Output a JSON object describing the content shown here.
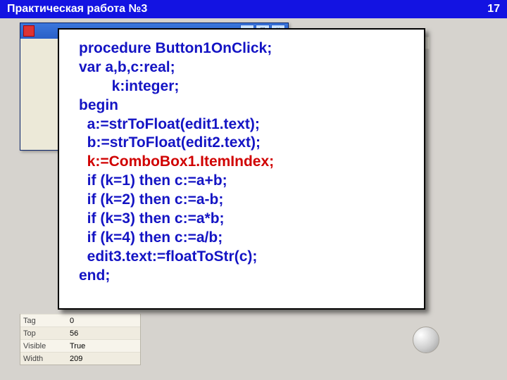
{
  "header": {
    "title": "Практическая работа №3",
    "page": "17"
  },
  "window": {
    "btn_min": "_",
    "btn_max": "□",
    "btn_close": "×"
  },
  "props": {
    "rows": [
      {
        "k": "Tag",
        "v": "0"
      },
      {
        "k": "Top",
        "v": "56"
      },
      {
        "k": "Visible",
        "v": "True"
      },
      {
        "k": "Width",
        "v": "209"
      }
    ]
  },
  "code": {
    "l1": "procedure Button1OnClick;",
    "l2": "var a,b,c:real;",
    "l3": "        k:integer;",
    "l4": "begin",
    "l5": "  a:=strToFloat(edit1.text);",
    "l6": "  b:=strToFloat(edit2.text);",
    "l7": "  k:=ComboBox1.ItemIndex;",
    "l8": "  if (k=1) then c:=a+b;",
    "l9": "  if (k=2) then c:=a-b;",
    "l10": "  if (k=3) then c:=a*b;",
    "l11": "  if (k=4) then c:=a/b;",
    "l12": "  edit3.text:=floatToStr(c);",
    "l13": "end;"
  }
}
